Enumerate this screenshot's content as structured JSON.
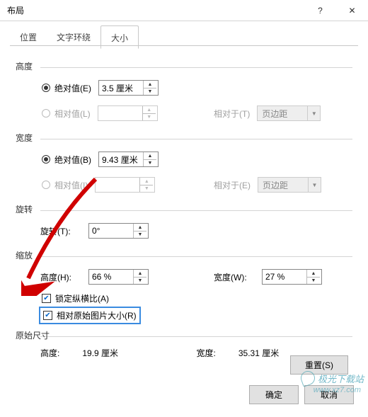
{
  "title": "布局",
  "tabs": {
    "position": "位置",
    "wrap": "文字环绕",
    "size": "大小"
  },
  "height": {
    "label": "高度",
    "abs": {
      "label": "绝对值(E)",
      "value": "3.5 厘米"
    },
    "rel": {
      "label": "相对值(L)",
      "value": "",
      "rel_to_label": "相对于(T)",
      "rel_to_value": "页边距"
    }
  },
  "width": {
    "label": "宽度",
    "abs": {
      "label": "绝对值(B)",
      "value": "9.43 厘米"
    },
    "rel": {
      "label": "相对值(I)",
      "value": "",
      "rel_to_label": "相对于(E)",
      "rel_to_value": "页边距"
    }
  },
  "rotation": {
    "label": "旋转",
    "angle_label": "旋转(T):",
    "angle_value": "0°"
  },
  "scale": {
    "label": "缩放",
    "h_label": "高度(H):",
    "h_value": "66 %",
    "w_label": "宽度(W):",
    "w_value": "27 %",
    "lock_label": "锁定纵横比(A)",
    "orig_label": "相对原始图片大小(R)"
  },
  "original": {
    "label": "原始尺寸",
    "h_label": "高度:",
    "h_value": "19.9 厘米",
    "w_label": "宽度:",
    "w_value": "35.31 厘米"
  },
  "buttons": {
    "reset": "重置(S)",
    "ok": "确定",
    "cancel": "取消"
  },
  "watermark": {
    "name": "极光下载站",
    "url": "www.xz7.com"
  }
}
